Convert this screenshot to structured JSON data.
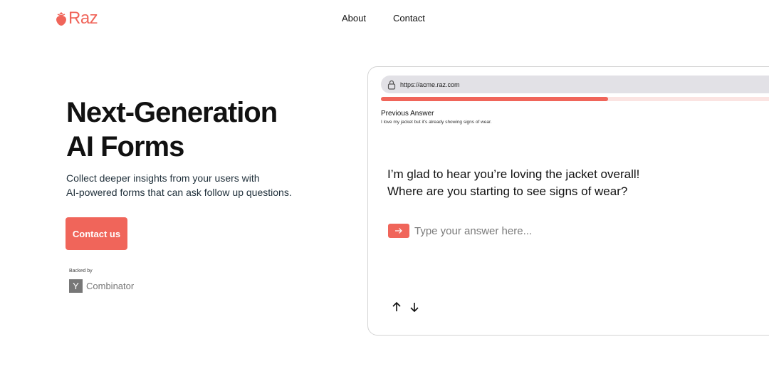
{
  "brand": {
    "name": "Raz",
    "color": "#f0655a",
    "icon": "strawberry-icon"
  },
  "nav": {
    "about": "About",
    "contact": "Contact"
  },
  "hero": {
    "title_line1": "Next-Generation",
    "title_line2": "AI Forms",
    "subtitle_line1": "Collect deeper insights from your users with",
    "subtitle_line2": "AI-powered forms that can ask follow up questions.",
    "cta_label": "Contact us"
  },
  "backing": {
    "label": "Backed by",
    "logo_letter": "Y",
    "name": "Combinator"
  },
  "demo": {
    "url": "https://acme.raz.com",
    "progress_fraction": 0.55,
    "previous_label": "Previous Answer",
    "previous_text": "I love my jacket but it’s already showing signs of wear.",
    "question_line1": "I’m glad to hear you’re loving the jacket overall!",
    "question_line2": "Where are you starting to see signs of wear?",
    "answer_placeholder": "Type your answer here...",
    "icons": {
      "submit": "arrow-right-icon",
      "prev": "arrow-up-icon",
      "next": "arrow-down-icon",
      "lock": "lock-icon"
    }
  }
}
